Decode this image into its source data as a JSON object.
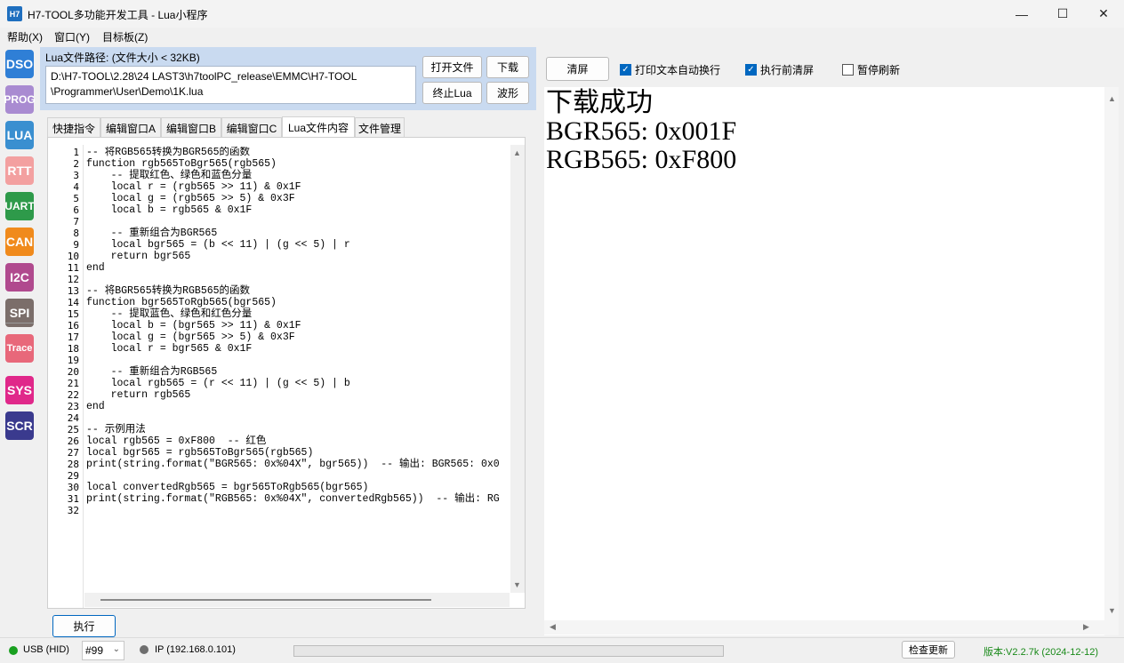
{
  "window": {
    "app_icon": "H7",
    "title": "H7-TOOL多功能开发工具 - Lua小程序",
    "minimize": "—",
    "maximize": "☐",
    "close": "✕"
  },
  "menu": [
    "帮助(X)",
    "窗口(Y)",
    "目标板(Z)"
  ],
  "sidebar": [
    {
      "label": "DSO",
      "color": "#2f7fd6"
    },
    {
      "label": "PROG",
      "color": "#a98bd1"
    },
    {
      "label": "LUA",
      "color": "#3a8fd0"
    },
    {
      "label": "RTT",
      "color": "#f3a0a0"
    },
    {
      "label": "UART",
      "color": "#2e9a4a"
    },
    {
      "label": "CAN",
      "color": "#f08a1c"
    },
    {
      "label": "I2C",
      "color": "#b04a8e"
    },
    {
      "label": "SPI",
      "color": "#7b6e6a"
    },
    {
      "label": "Trace",
      "color": "#e8687a"
    },
    {
      "label": "SYS",
      "color": "#e0288a"
    },
    {
      "label": "SCR",
      "color": "#3a3a8e"
    }
  ],
  "file_panel": {
    "path_label": "Lua文件路径: (文件大小 < 32KB)",
    "path_value": "D:\\H7-TOOL\\2.28\\24 LAST3\\h7toolPC_release\\EMMC\\H7-TOOL\n\\Programmer\\User\\Demo\\1K.lua",
    "open_file": "打开文件",
    "download": "下载",
    "stop_lua": "终止Lua",
    "waveform": "波形"
  },
  "tabs": [
    {
      "label": "快捷指令",
      "active": false
    },
    {
      "label": "编辑窗口A",
      "active": false
    },
    {
      "label": "编辑窗口B",
      "active": false
    },
    {
      "label": "编辑窗口C",
      "active": false
    },
    {
      "label": "Lua文件内容",
      "active": true
    },
    {
      "label": "文件管理",
      "active": false
    }
  ],
  "code_lines": [
    "-- 将RGB565转换为BGR565的函数",
    "function rgb565ToBgr565(rgb565)",
    "    -- 提取红色、绿色和蓝色分量",
    "    local r = (rgb565 >> 11) & 0x1F",
    "    local g = (rgb565 >> 5) & 0x3F",
    "    local b = rgb565 & 0x1F",
    "",
    "    -- 重新组合为BGR565",
    "    local bgr565 = (b << 11) | (g << 5) | r",
    "    return bgr565",
    "end",
    "",
    "-- 将BGR565转换为RGB565的函数",
    "function bgr565ToRgb565(bgr565)",
    "    -- 提取蓝色、绿色和红色分量",
    "    local b = (bgr565 >> 11) & 0x1F",
    "    local g = (bgr565 >> 5) & 0x3F",
    "    local r = bgr565 & 0x1F",
    "",
    "    -- 重新组合为RGB565",
    "    local rgb565 = (r << 11) | (g << 5) | b",
    "    return rgb565",
    "end",
    "",
    "-- 示例用法",
    "local rgb565 = 0xF800  -- 红色",
    "local bgr565 = rgb565ToBgr565(rgb565)",
    "print(string.format(\"BGR565: 0x%04X\", bgr565))  -- 输出: BGR565: 0x0",
    "",
    "local convertedRgb565 = bgr565ToRgb565(bgr565)",
    "print(string.format(\"RGB565: 0x%04X\", convertedRgb565))  -- 输出: RG",
    ""
  ],
  "run_button": "执行",
  "output_toolbar": {
    "clear": "清屏",
    "auto_wrap": {
      "label": "打印文本自动换行",
      "checked": true
    },
    "clear_before_run": {
      "label": "执行前清屏",
      "checked": true
    },
    "pause_refresh": {
      "label": "暂停刷新",
      "checked": false
    }
  },
  "output_lines": [
    "下载成功",
    "BGR565: 0x001F",
    "RGB565: 0xF800"
  ],
  "status": {
    "usb": "USB (HID)",
    "usb_color": "#19a020",
    "device": "#99",
    "ip": "IP (192.168.0.101)",
    "ip_color": "#6e6e6e",
    "check_update": "检查更新",
    "version": "版本:V2.2.7k (2024-12-12)",
    "version_color": "#1a8a1a"
  }
}
